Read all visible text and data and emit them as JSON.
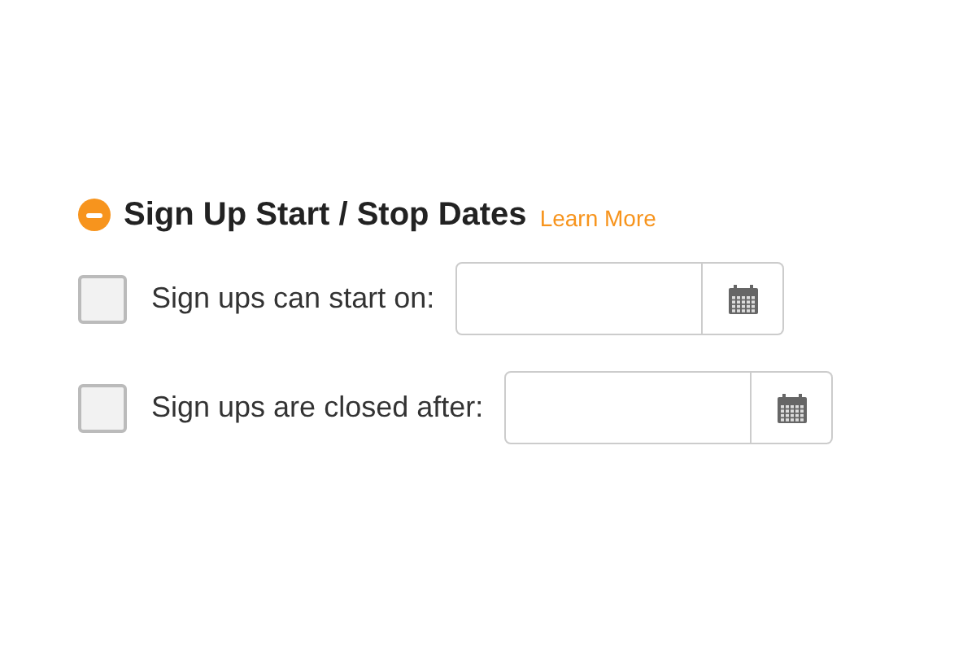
{
  "section": {
    "title": "Sign Up Start / Stop Dates",
    "expanded": true,
    "link": "Learn More"
  },
  "rows": [
    {
      "label": "Sign ups can start on:",
      "checked": false
    },
    {
      "label": "Sign ups are closed after:",
      "checked": false
    }
  ]
}
